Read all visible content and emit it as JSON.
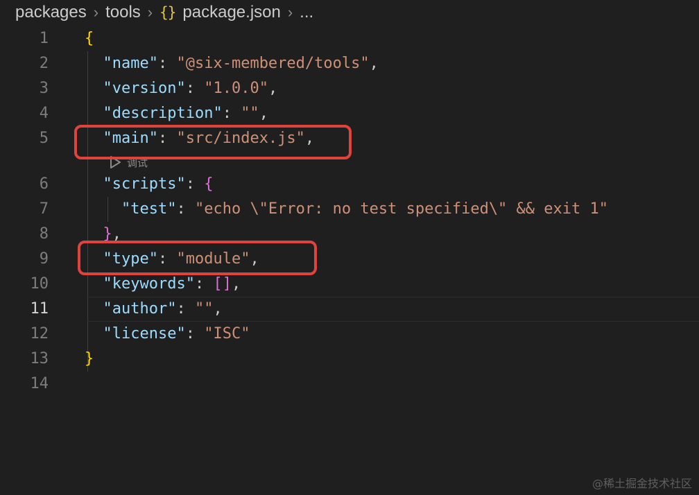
{
  "breadcrumb": {
    "items": [
      "packages",
      "tools",
      "package.json",
      "..."
    ],
    "file_icon": "json-braces-icon",
    "file_icon_glyph": "{}"
  },
  "codelens": {
    "icon": "play-icon",
    "label": "调试"
  },
  "active_line": 11,
  "lines": [
    {
      "num": "1"
    },
    {
      "num": "2",
      "key": "\"name\"",
      "value": "\"@six-membered/tools\""
    },
    {
      "num": "3",
      "key": "\"version\"",
      "value": "\"1.0.0\""
    },
    {
      "num": "4",
      "key": "\"description\"",
      "value": "\"\""
    },
    {
      "num": "5",
      "key": "\"main\"",
      "value": "\"src/index.js\""
    },
    {
      "num": "6",
      "key": "\"scripts\""
    },
    {
      "num": "7",
      "key": "\"test\"",
      "value": "\"echo \\\"Error: no test specified\\\" && exit 1\""
    },
    {
      "num": "8"
    },
    {
      "num": "9",
      "key": "\"type\"",
      "value": "\"module\""
    },
    {
      "num": "10",
      "key": "\"keywords\""
    },
    {
      "num": "11",
      "key": "\"author\"",
      "value": "\"\""
    },
    {
      "num": "12",
      "key": "\"license\"",
      "value": "\"ISC\""
    },
    {
      "num": "13"
    },
    {
      "num": "14"
    }
  ],
  "colors": {
    "key": "#9cdcfe",
    "string": "#ce9178",
    "brace_level1": "#ffd700",
    "brace_level2": "#da70d6",
    "annotation_box": "#e0433c"
  },
  "watermark": "@稀土掘金技术社区"
}
